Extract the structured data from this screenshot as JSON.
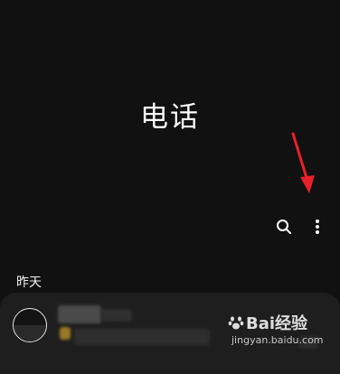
{
  "header": {
    "title": "电话"
  },
  "toolbar": {
    "search_icon": "search-icon",
    "more_icon": "more-vert-icon"
  },
  "annotation": {
    "arrow_color": "#e8202a"
  },
  "call_log": {
    "section_label": "昨天",
    "entries": [
      {
        "name": "",
        "detail": ""
      }
    ]
  },
  "watermark": {
    "brand": "Bai经验",
    "url": "jingyan.baidu.com"
  }
}
